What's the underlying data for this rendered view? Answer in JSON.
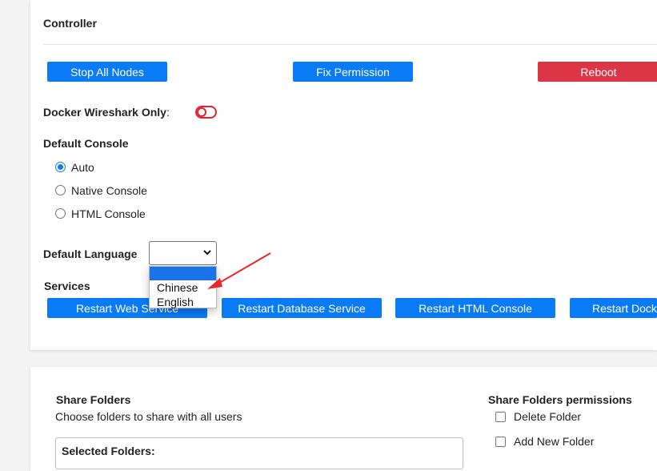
{
  "controller": {
    "title": "Controller",
    "buttons": {
      "stop_all": "Stop All Nodes",
      "fix_permission": "Fix Permission",
      "reboot": "Reboot"
    },
    "wireshark_label": "Docker Wireshark Only",
    "wireshark_colon": ":",
    "wireshark_enabled": false,
    "default_console": {
      "title": "Default Console",
      "options": [
        "Auto",
        "Native Console",
        "HTML Console"
      ],
      "selected": "Auto"
    },
    "default_language": {
      "label": "Default Language",
      "current_value": "",
      "options": [
        "Chinese",
        "English"
      ]
    },
    "services": {
      "title": "Services",
      "buttons": [
        "Restart Web Service",
        "Restart Database Service",
        "Restart HTML Console",
        "Restart Docker"
      ]
    }
  },
  "share": {
    "title": "Share Folders",
    "subtitle": "Choose folders to share with all users",
    "selected_folders_label": "Selected Folders:",
    "permissions_title": "Share Folders permissions",
    "permissions": [
      "Delete Folder",
      "Add New Folder"
    ]
  },
  "colors": {
    "primary": "#0a7bf6",
    "danger": "#dc3545",
    "toggle_off": "#e0242f",
    "annotation_arrow": "#e8272e"
  }
}
